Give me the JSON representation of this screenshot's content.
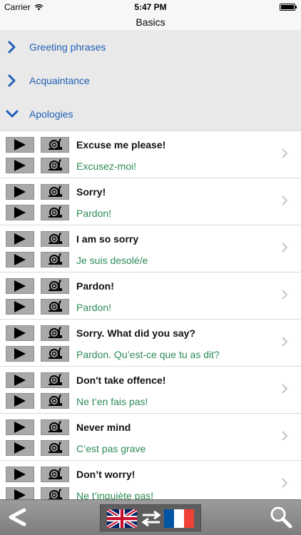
{
  "status_bar": {
    "carrier": "Carrier",
    "time": "5:47 PM"
  },
  "nav": {
    "title": "Basics"
  },
  "categories": [
    {
      "label": "Greeting phrases",
      "expanded": false
    },
    {
      "label": "Acquaintance",
      "expanded": false
    },
    {
      "label": "Apologies",
      "expanded": true
    }
  ],
  "phrases": [
    {
      "en": "Excuse me please!",
      "fr": "Excusez-moi!"
    },
    {
      "en": "Sorry!",
      "fr": "Pardon!"
    },
    {
      "en": "I am so sorry",
      "fr": "Je suis desolé/e"
    },
    {
      "en": "Pardon!",
      "fr": "Pardon!"
    },
    {
      "en": "Sorry. What did you say?",
      "fr": "Pardon. Qu’est-ce que tu as dit?"
    },
    {
      "en": "Don't take offence!",
      "fr": "Ne t’en fais pas!"
    },
    {
      "en": "Never mind",
      "fr": "C’est pas grave"
    },
    {
      "en": "Don’t worry!",
      "fr": "Ne t’inquiète pas!"
    }
  ],
  "icons": {
    "play": "play-icon",
    "slow": "snail-icon",
    "row_chevron": "chevron-right-icon",
    "category_collapsed": "chevron-right-icon",
    "category_expanded": "chevron-down-icon",
    "back": "back-icon",
    "search": "search-icon"
  },
  "colors": {
    "category_text": "#1f5fb5",
    "translation_text": "#2e8b57",
    "category_bg": "#e9e9e9",
    "toolbar_bg": "#8c8c8c"
  }
}
